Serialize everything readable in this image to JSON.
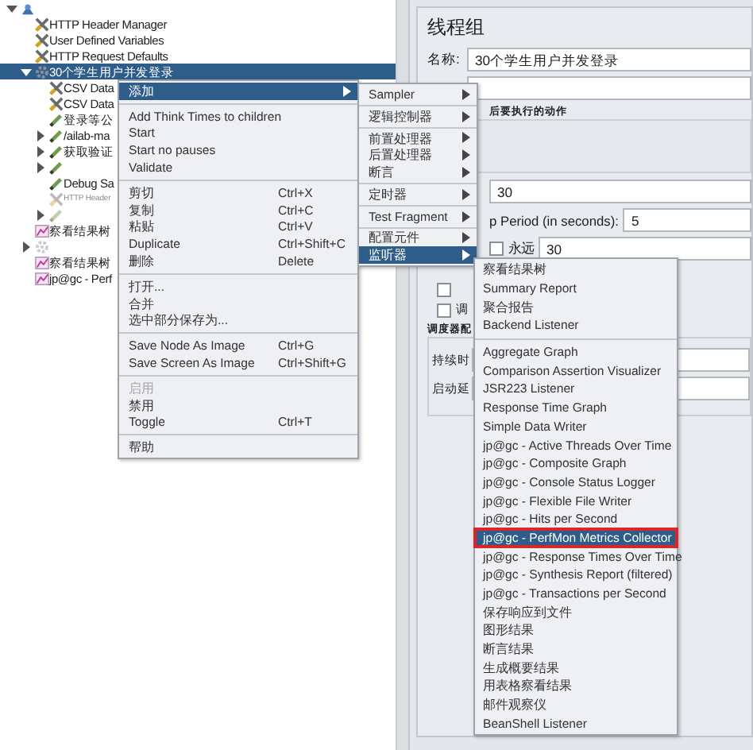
{
  "tree": {
    "items": [
      {
        "kind": "plan",
        "expanded": true,
        "children": [
          {
            "label": "HTTP Header Manager",
            "kind": "config",
            "selected": false
          },
          {
            "label": "User Defined Variables",
            "kind": "config",
            "selected": false
          },
          {
            "label": "HTTP Request Defaults",
            "kind": "config",
            "selected": false
          },
          {
            "label": "30个学生用户并发登录",
            "kind": "group",
            "selected": true,
            "expanded": true,
            "children": [
              {
                "label": "CSV Data",
                "kind": "config",
                "selected": false
              },
              {
                "label": "CSV Data",
                "kind": "config",
                "selected": false
              },
              {
                "label": "登录等公",
                "kind": "sampler",
                "selected": false
              },
              {
                "label": "/ailab-ma",
                "kind": "sampler",
                "selected": false,
                "expanded": false
              },
              {
                "label": "获取验证",
                "kind": "sampler",
                "selected": false,
                "expanded": false
              },
              {
                "kind": "sampler",
                "selected": false,
                "expanded": false
              },
              {
                "label": "Debug Sa",
                "kind": "sampler",
                "selected": false
              },
              {
                "label": "HTTP Header",
                "kind": "config",
                "selected": false,
                "disabled": true
              },
              {
                "kind": "sampler",
                "selected": false,
                "expanded": false,
                "disabled": true
              }
            ]
          },
          {
            "label": "察看结果树",
            "kind": "listener",
            "selected": false
          },
          {
            "kind": "group",
            "selected": false,
            "expanded": false,
            "disabled": true
          },
          {
            "label": "察看结果树",
            "kind": "listener",
            "selected": false
          },
          {
            "label": "jp@gc - Perf",
            "kind": "listener",
            "selected": false
          }
        ]
      }
    ]
  },
  "context_menu": {
    "items": [
      {
        "kind": "item",
        "label": "添加",
        "selected": true,
        "submenu": true
      },
      {
        "kind": "separator"
      },
      {
        "kind": "item",
        "label": "Add Think Times to children",
        "selected": false
      },
      {
        "kind": "item",
        "label": "Start",
        "selected": false
      },
      {
        "kind": "item",
        "label": "Start no pauses",
        "selected": false
      },
      {
        "kind": "item",
        "label": "Validate",
        "selected": false
      },
      {
        "kind": "separator"
      },
      {
        "kind": "item",
        "label": "剪切",
        "shortcut": "Ctrl+X",
        "selected": false
      },
      {
        "kind": "item",
        "label": "复制",
        "shortcut": "Ctrl+C",
        "selected": false
      },
      {
        "kind": "item",
        "label": "粘贴",
        "shortcut": "Ctrl+V",
        "selected": false
      },
      {
        "kind": "item",
        "label": "Duplicate",
        "shortcut": "Ctrl+Shift+C",
        "selected": false
      },
      {
        "kind": "item",
        "label": "删除",
        "shortcut": "Delete",
        "selected": false
      },
      {
        "kind": "separator"
      },
      {
        "kind": "item",
        "label": "打开...",
        "selected": false
      },
      {
        "kind": "item",
        "label": "合并",
        "selected": false
      },
      {
        "kind": "item",
        "label": "选中部分保存为...",
        "selected": false
      },
      {
        "kind": "separator"
      },
      {
        "kind": "item",
        "label": "Save Node As Image",
        "shortcut": "Ctrl+G",
        "selected": false
      },
      {
        "kind": "item",
        "label": "Save Screen As Image",
        "shortcut": "Ctrl+Shift+G",
        "selected": false
      },
      {
        "kind": "separator"
      },
      {
        "kind": "item",
        "label": "启用",
        "selected": false,
        "disabled": true
      },
      {
        "kind": "item",
        "label": "禁用",
        "selected": false
      },
      {
        "kind": "item",
        "label": "Toggle",
        "shortcut": "Ctrl+T",
        "selected": false
      },
      {
        "kind": "separator"
      },
      {
        "kind": "item",
        "label": "帮助",
        "selected": false
      }
    ]
  },
  "add_menu": {
    "items": [
      {
        "kind": "item",
        "label": "Sampler",
        "selected": false,
        "submenu": true
      },
      {
        "kind": "separator"
      },
      {
        "kind": "item",
        "label": "逻辑控制器",
        "selected": false,
        "submenu": true
      },
      {
        "kind": "separator"
      },
      {
        "kind": "item",
        "label": "前置处理器",
        "selected": false,
        "submenu": true
      },
      {
        "kind": "item",
        "label": "后置处理器",
        "selected": false,
        "submenu": true
      },
      {
        "kind": "item",
        "label": "断言",
        "selected": false,
        "submenu": true
      },
      {
        "kind": "separator"
      },
      {
        "kind": "item",
        "label": "定时器",
        "selected": false,
        "submenu": true
      },
      {
        "kind": "separator"
      },
      {
        "kind": "item",
        "label": "Test Fragment",
        "selected": false,
        "submenu": true
      },
      {
        "kind": "separator"
      },
      {
        "kind": "item",
        "label": "配置元件",
        "selected": false,
        "submenu": true
      },
      {
        "kind": "item",
        "label": "监听器",
        "selected": true,
        "submenu": true
      }
    ]
  },
  "listener_menu": {
    "items": [
      {
        "kind": "item",
        "label": "察看结果树",
        "selected": false
      },
      {
        "kind": "item",
        "label": "Summary Report",
        "selected": false
      },
      {
        "kind": "item",
        "label": "聚合报告",
        "selected": false
      },
      {
        "kind": "item",
        "label": "Backend Listener",
        "selected": false
      },
      {
        "kind": "separator"
      },
      {
        "kind": "item",
        "label": "Aggregate Graph",
        "selected": false
      },
      {
        "kind": "item",
        "label": "Comparison Assertion Visualizer",
        "selected": false
      },
      {
        "kind": "item",
        "label": "JSR223 Listener",
        "selected": false
      },
      {
        "kind": "item",
        "label": "Response Time Graph",
        "selected": false
      },
      {
        "kind": "item",
        "label": "Simple Data Writer",
        "selected": false
      },
      {
        "kind": "item",
        "label": "jp@gc - Active Threads Over Time",
        "selected": false
      },
      {
        "kind": "item",
        "label": "jp@gc - Composite Graph",
        "selected": false
      },
      {
        "kind": "item",
        "label": "jp@gc - Console Status Logger",
        "selected": false
      },
      {
        "kind": "item",
        "label": "jp@gc - Flexible File Writer",
        "selected": false
      },
      {
        "kind": "item",
        "label": "jp@gc - Hits per Second",
        "selected": false
      },
      {
        "kind": "item",
        "label": "jp@gc - PerfMon Metrics Collector",
        "selected": true,
        "highlighted": true
      },
      {
        "kind": "item",
        "label": "jp@gc - Response Times Over Time",
        "selected": false
      },
      {
        "kind": "item",
        "label": "jp@gc - Synthesis Report (filtered)",
        "selected": false
      },
      {
        "kind": "item",
        "label": "jp@gc - Transactions per Second",
        "selected": false
      },
      {
        "kind": "item",
        "label": "保存响应到文件",
        "selected": false
      },
      {
        "kind": "item",
        "label": "图形结果",
        "selected": false
      },
      {
        "kind": "item",
        "label": "断言结果",
        "selected": false
      },
      {
        "kind": "item",
        "label": "生成概要结果",
        "selected": false
      },
      {
        "kind": "item",
        "label": "用表格察看结果",
        "selected": false
      },
      {
        "kind": "item",
        "label": "邮件观察仪",
        "selected": false
      },
      {
        "kind": "item",
        "label": "BeanShell Listener",
        "selected": false
      }
    ]
  },
  "editor": {
    "title": "线程组",
    "name_label": "名称:",
    "name_value": "30个学生用户并发登录",
    "error_action_heading": "后要执行的动作",
    "thread_count": "30",
    "ramp_label": "p Period (in seconds):",
    "ramp_value": "5",
    "forever_label": "永远",
    "forever_checked": false,
    "loop_value": "30",
    "checkboxes": [
      {
        "checked": false
      },
      {
        "label": "调",
        "checked": false
      }
    ],
    "scheduler_heading": "调度器配",
    "duration_label": "持续时",
    "delay_label": "启动延"
  }
}
